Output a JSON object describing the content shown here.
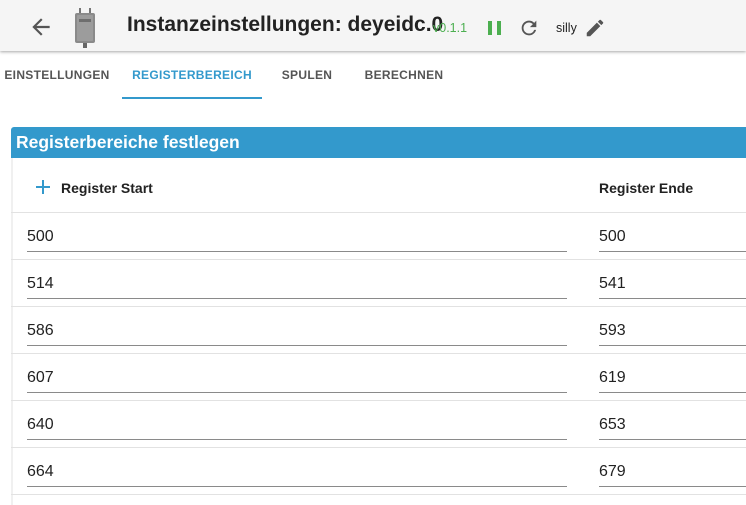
{
  "header": {
    "title": "Instanzeinstellungen: deyeidc.0",
    "version": "v0.1.1",
    "log_level": "silly",
    "accent_color": "#3399cc",
    "version_color": "#4caf50"
  },
  "tabs": [
    {
      "label": "EINSTELLUNGEN",
      "active": false
    },
    {
      "label": "REGISTERBEREICH",
      "active": true
    },
    {
      "label": "SPULEN",
      "active": false
    },
    {
      "label": "BERECHNEN",
      "active": false
    }
  ],
  "section": {
    "title": "Registerbereiche festlegen"
  },
  "table": {
    "columns": {
      "start": "Register Start",
      "end": "Register Ende"
    },
    "rows": [
      {
        "start": "500",
        "end": "500"
      },
      {
        "start": "514",
        "end": "541"
      },
      {
        "start": "586",
        "end": "593"
      },
      {
        "start": "607",
        "end": "619"
      },
      {
        "start": "640",
        "end": "653"
      },
      {
        "start": "664",
        "end": "679"
      }
    ]
  },
  "icons": {
    "back": "arrow-back-icon",
    "logo": "deye-inverter-logo",
    "pause": "pause-icon",
    "reload": "reload-icon",
    "edit": "pencil-icon",
    "add": "plus-icon"
  }
}
